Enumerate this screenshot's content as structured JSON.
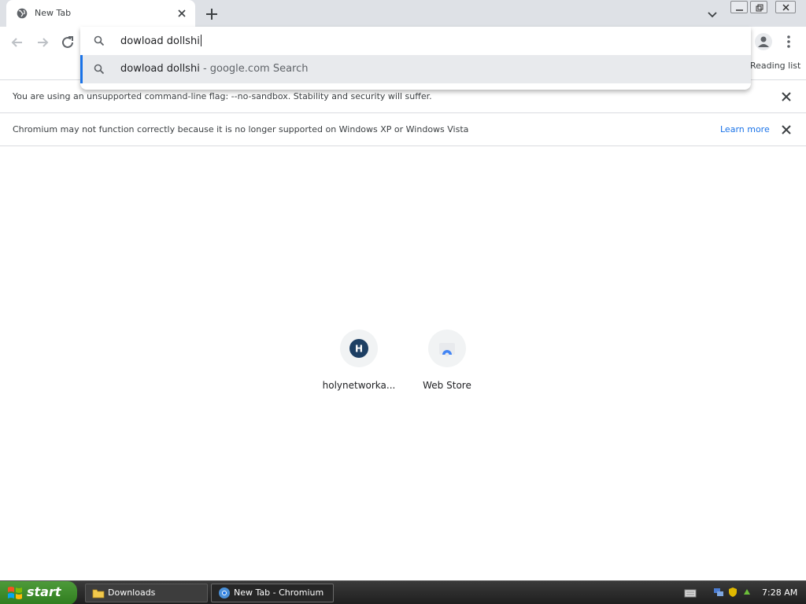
{
  "tab": {
    "title": "New Tab"
  },
  "toolbar": {
    "reading_list": "Reading list"
  },
  "omnibox": {
    "input_value": "dowload dollshi",
    "suggestion_main": "dowload dollshi",
    "suggestion_sub": " - google.com Search"
  },
  "infobars": [
    {
      "message": "You are using an unsupported command-line flag: --no-sandbox. Stability and security will suffer."
    },
    {
      "message": "Chromium may not function correctly because it is no longer supported on Windows XP or Windows Vista",
      "link": "Learn more"
    }
  ],
  "shortcuts": [
    {
      "label": "holynetworka...",
      "initial": "H"
    },
    {
      "label": "Web Store"
    }
  ],
  "taskbar": {
    "start_label": "start",
    "items": [
      {
        "label": "Downloads"
      },
      {
        "label": "New Tab - Chromium"
      }
    ],
    "clock": "7:28 AM"
  },
  "colors": {
    "accent": "#1a73e8",
    "tabstrip": "#dee1e6",
    "suggestion_bg": "#e8eaed",
    "shortcut_h_bg": "#1d3f63"
  },
  "icons": [
    "globe-icon",
    "close-icon",
    "plus-icon",
    "chevron-down-icon",
    "back-icon",
    "forward-icon",
    "reload-icon",
    "search-icon",
    "profile-icon",
    "menu-icon",
    "folder-icon",
    "chromium-icon",
    "windows-logo-icon"
  ]
}
